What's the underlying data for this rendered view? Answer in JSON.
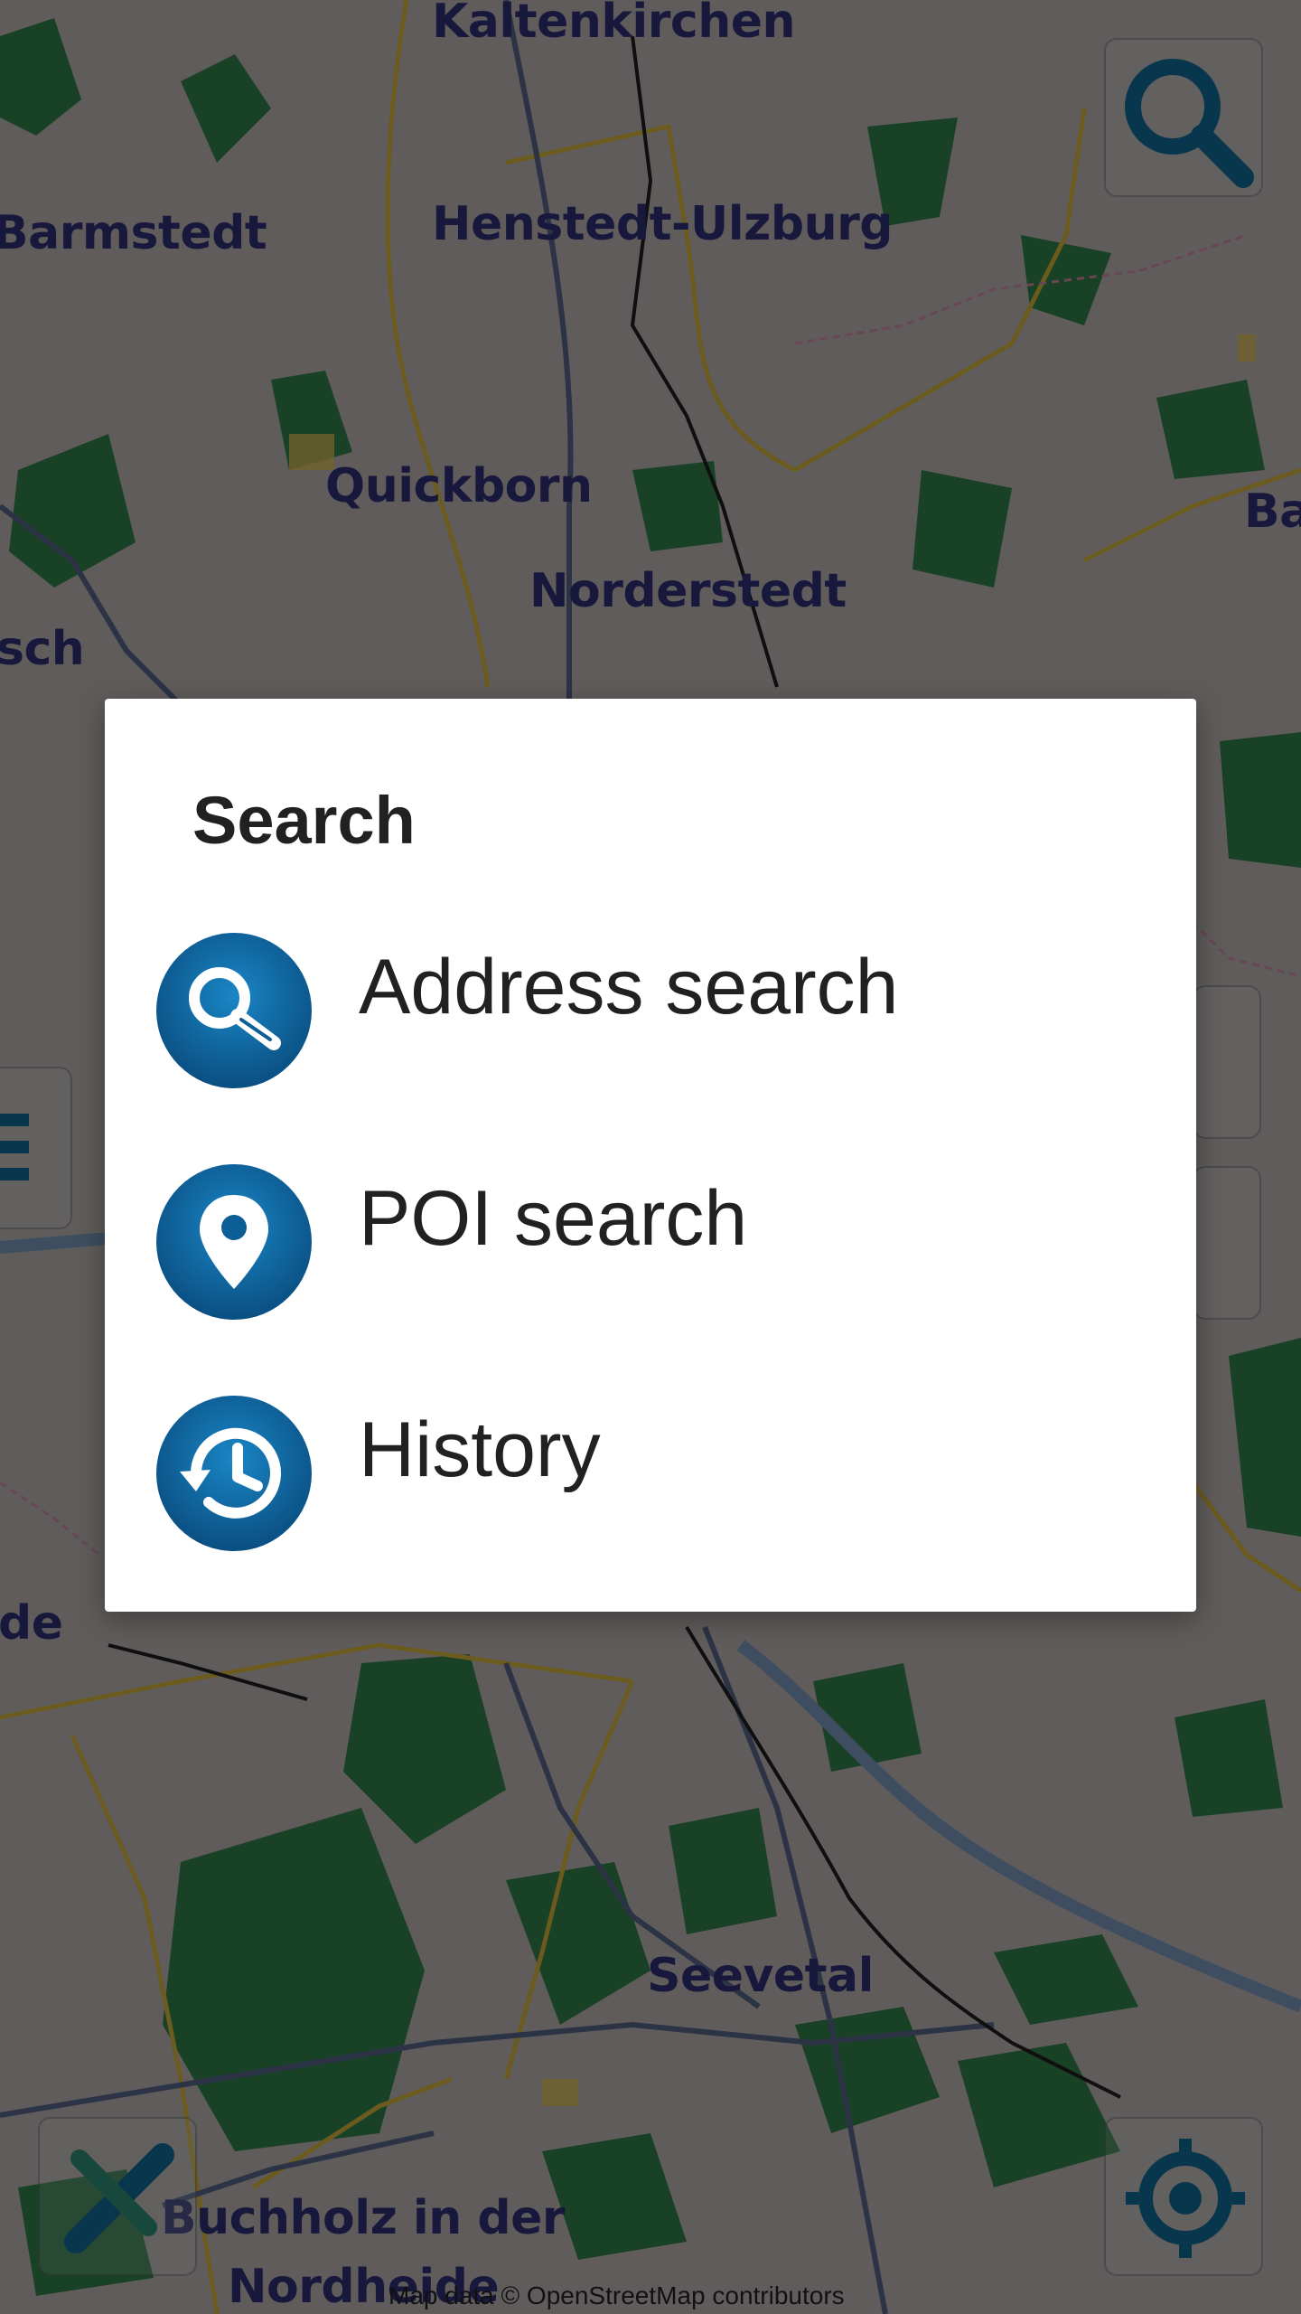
{
  "map": {
    "places": [
      {
        "name": "Kaltenkirchen"
      },
      {
        "name": "Barmstedt"
      },
      {
        "name": "Henstedt-Ulzburg"
      },
      {
        "name": "Quickborn"
      },
      {
        "name": "Norderstedt"
      },
      {
        "name": "Ba"
      },
      {
        "name": "sch"
      },
      {
        "name": "de"
      },
      {
        "name": "Seevetal"
      },
      {
        "name": "Buchholz in der"
      },
      {
        "name": "Nordheide"
      }
    ],
    "attribution": "Map data © OpenStreetMap contributors",
    "colors": {
      "land": "#8a8685",
      "forest": "#1f5a35",
      "water": "#6b87a5",
      "road_major": "#9c8a3a",
      "road_primary": "#3c4a6c",
      "label": "#2a2a6a",
      "accent_button": "#0f5e86"
    }
  },
  "map_controls": {
    "search_button_icon": "search-icon",
    "measure_button_icon": "ruler-pencil-icon",
    "locate_button_icon": "crosshair-location-icon"
  },
  "dialog": {
    "title": "Search",
    "items": [
      {
        "label": "Address search",
        "icon": "magnifier-icon"
      },
      {
        "label": "POI search",
        "icon": "map-pin-icon"
      },
      {
        "label": "History",
        "icon": "history-icon"
      }
    ],
    "icon_color": "#0c5f96"
  }
}
